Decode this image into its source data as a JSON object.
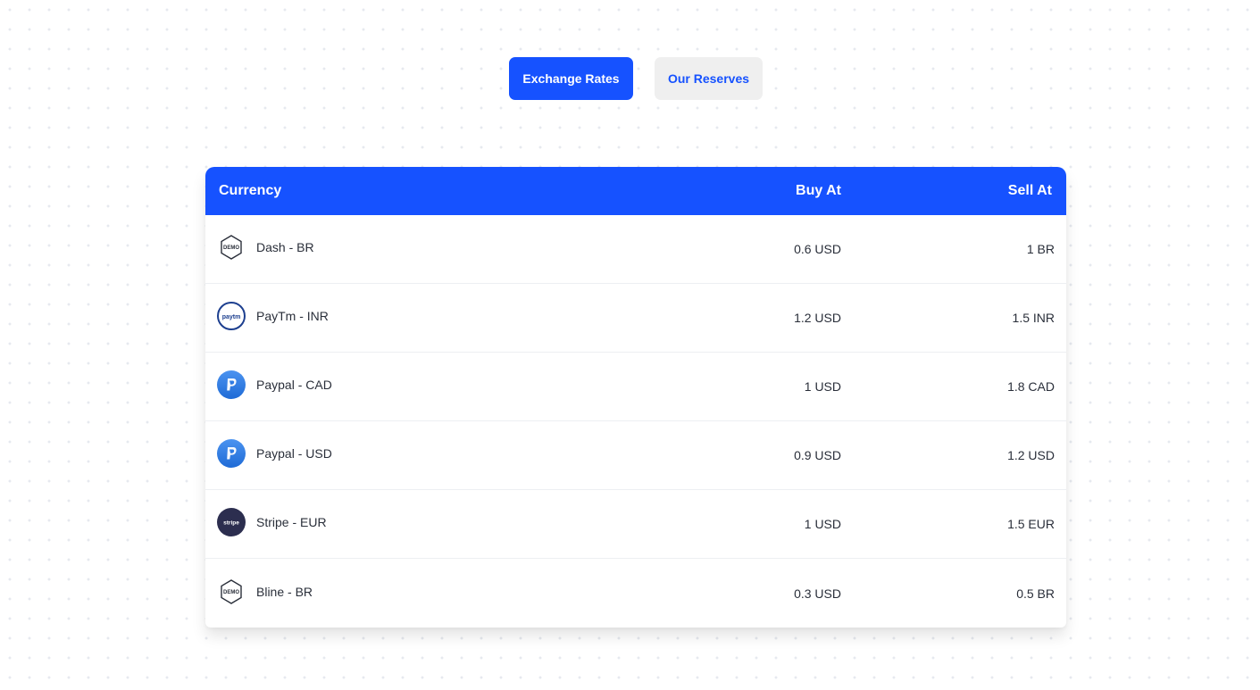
{
  "tabs": {
    "exchange_rates": "Exchange Rates",
    "our_reserves": "Our Reserves"
  },
  "table": {
    "headers": {
      "currency": "Currency",
      "buy_at": "Buy At",
      "sell_at": "Sell At"
    },
    "rows": [
      {
        "icon": "demo-hexagon-icon",
        "currency": "Dash - BR",
        "buy_at": "0.6 USD",
        "sell_at": "1 BR"
      },
      {
        "icon": "paytm-icon",
        "currency": "PayTm - INR",
        "buy_at": "1.2 USD",
        "sell_at": "1.5 INR"
      },
      {
        "icon": "paypal-icon",
        "currency": "Paypal - CAD",
        "buy_at": "1 USD",
        "sell_at": "1.8 CAD"
      },
      {
        "icon": "paypal-icon",
        "currency": "Paypal - USD",
        "buy_at": "0.9 USD",
        "sell_at": "1.2 USD"
      },
      {
        "icon": "stripe-icon",
        "currency": "Stripe - EUR",
        "buy_at": "1 USD",
        "sell_at": "1.5 EUR"
      },
      {
        "icon": "demo-hexagon-icon",
        "currency": "Bline - BR",
        "buy_at": "0.3 USD",
        "sell_at": "0.5 BR"
      }
    ]
  },
  "logos": {
    "demo_text": "DEMO",
    "paytm_text": "paytm",
    "stripe_text": "stripe"
  },
  "colors": {
    "accent": "#1652ff",
    "inactive_tab_bg": "#efefef",
    "stripe_bg": "#2c2e4f",
    "paypal_blue": "#2f7be3"
  }
}
